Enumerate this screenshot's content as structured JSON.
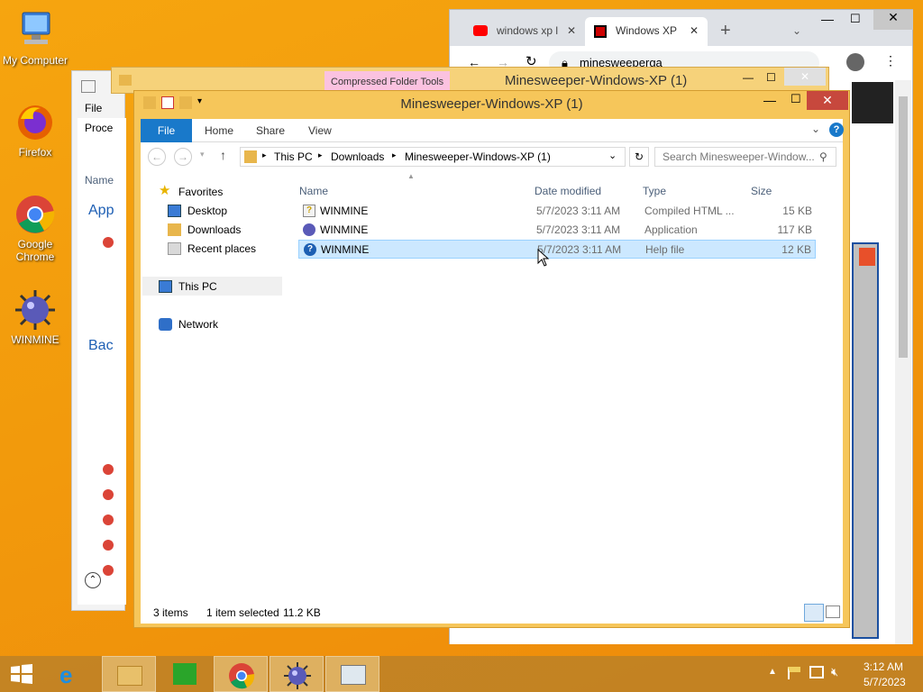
{
  "desktop": {
    "icons": [
      {
        "label": "My Computer"
      },
      {
        "label": "Firefox"
      },
      {
        "label": "Google Chrome"
      },
      {
        "label": "WINMINE"
      }
    ]
  },
  "browser": {
    "tabs": [
      {
        "label": "windows xp l",
        "icon": "youtube-icon"
      },
      {
        "label": "Windows XP",
        "icon": "minesweeper-favicon"
      }
    ],
    "url": "minesweeperga"
  },
  "back_window": {
    "ribbon_context": "Compressed Folder Tools",
    "title": "Minesweeper-Windows-XP (1)"
  },
  "task_manager": {
    "menu_file": "File",
    "tab_label": "Proce",
    "col_name": "Name",
    "group_apps": "App",
    "group_background": "Bac"
  },
  "explorer": {
    "title": "Minesweeper-Windows-XP (1)",
    "ribbon": {
      "file": "File",
      "home": "Home",
      "share": "Share",
      "view": "View"
    },
    "breadcrumb": [
      "This PC",
      "Downloads",
      "Minesweeper-Windows-XP (1)"
    ],
    "search_placeholder": "Search Minesweeper-Window...",
    "nav": {
      "favorites": "Favorites",
      "desktop": "Desktop",
      "downloads": "Downloads",
      "recent": "Recent places",
      "this_pc": "This PC",
      "network": "Network"
    },
    "columns": {
      "name": "Name",
      "date": "Date modified",
      "type": "Type",
      "size": "Size"
    },
    "files": [
      {
        "name": "WINMINE",
        "date": "5/7/2023 3:11 AM",
        "type": "Compiled HTML ...",
        "size": "15 KB",
        "icon": "chm-icon"
      },
      {
        "name": "WINMINE",
        "date": "5/7/2023 3:11 AM",
        "type": "Application",
        "size": "117 KB",
        "icon": "mine-icon"
      },
      {
        "name": "WINMINE",
        "date": "5/7/2023 3:11 AM",
        "type": "Help file",
        "size": "12 KB",
        "icon": "help-icon",
        "selected": true
      }
    ],
    "status": {
      "items": "3 items",
      "selected": "1 item selected",
      "size": "11.2 KB"
    }
  },
  "taskbar": {
    "time": "3:12 AM",
    "date": "5/7/2023"
  },
  "colors": {
    "accent": "#1979ca",
    "selection": "#cce8ff",
    "frame": "#f6c65a"
  }
}
